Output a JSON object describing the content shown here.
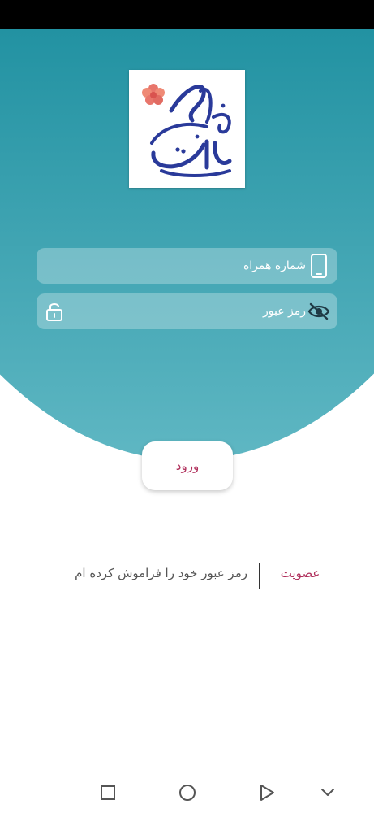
{
  "colors": {
    "primary_teal": "#13899a",
    "accent": "#b0305c",
    "text_muted": "#555555"
  },
  "logo": {
    "text_line1": "حواهر",
    "text_line2": "سانیا"
  },
  "form": {
    "phone": {
      "placeholder": "شماره همراه",
      "value": "",
      "icon": "mobile-phone-icon"
    },
    "password": {
      "placeholder": "رمز عبور",
      "value": "",
      "icon_visibility": "eye-slash-icon",
      "icon_lock": "unlock-icon"
    }
  },
  "actions": {
    "login_label": "ورود",
    "register_label": "عضویت",
    "forgot_label": "رمز عبور خود را فراموش کرده ام"
  },
  "navbar": {
    "icons": [
      "square-icon",
      "circle-icon",
      "triangle-play-icon",
      "chevron-down-icon"
    ]
  }
}
